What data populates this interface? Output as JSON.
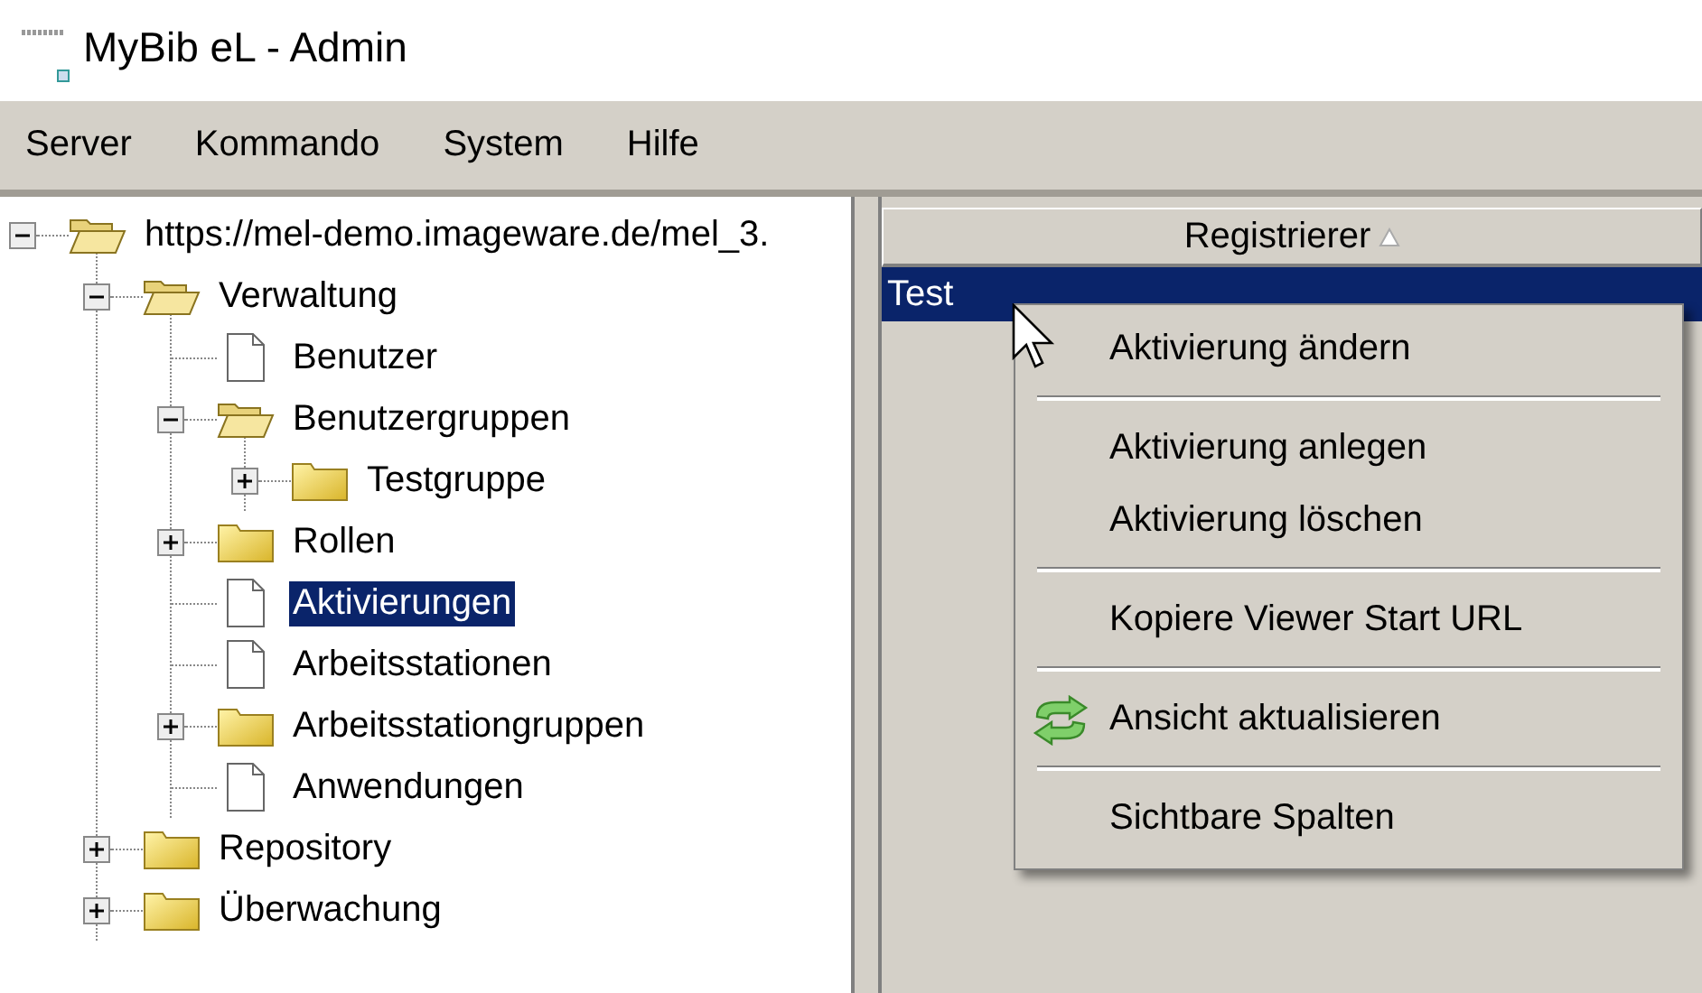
{
  "window": {
    "title": "MyBib eL - Admin"
  },
  "menu_bar": [
    "Server",
    "Kommando",
    "System",
    "Hilfe"
  ],
  "tree": [
    {
      "label": "https://mel-demo.imageware.de/mel_3.",
      "kind": "folder",
      "expanded": true,
      "selected": false,
      "children": [
        {
          "label": "Verwaltung",
          "kind": "folder",
          "expanded": true,
          "selected": false,
          "children": [
            {
              "label": "Benutzer",
              "kind": "page",
              "selected": false
            },
            {
              "label": "Benutzergruppen",
              "kind": "folder",
              "expanded": true,
              "selected": false,
              "children": [
                {
                  "label": "Testgruppe",
                  "kind": "folder",
                  "expanded": false,
                  "selected": false
                }
              ]
            },
            {
              "label": "Rollen",
              "kind": "folder",
              "expanded": false,
              "selected": false
            },
            {
              "label": "Aktivierungen",
              "kind": "page",
              "selected": true
            },
            {
              "label": "Arbeitsstationen",
              "kind": "page",
              "selected": false
            },
            {
              "label": "Arbeitsstationgruppen",
              "kind": "folder",
              "expanded": false,
              "selected": false
            },
            {
              "label": "Anwendungen",
              "kind": "page",
              "selected": false
            }
          ]
        },
        {
          "label": "Repository",
          "kind": "folder",
          "expanded": false,
          "selected": false
        },
        {
          "label": "Überwachung",
          "kind": "folder",
          "expanded": false,
          "selected": false
        }
      ]
    }
  ],
  "table": {
    "columns": [
      {
        "label": "Registrierer",
        "sorted_ascending": true
      }
    ],
    "rows": [
      {
        "cells": [
          "Test"
        ],
        "selected": true
      }
    ]
  },
  "context_menu": [
    {
      "kind": "action",
      "label": "Aktivierung ändern"
    },
    {
      "kind": "separator"
    },
    {
      "kind": "action",
      "label": "Aktivierung anlegen"
    },
    {
      "kind": "action",
      "label": "Aktivierung löschen"
    },
    {
      "kind": "separator"
    },
    {
      "kind": "action",
      "label": "Kopiere Viewer Start URL"
    },
    {
      "kind": "separator"
    },
    {
      "kind": "refresh_action",
      "label": "Ansicht aktualisieren"
    },
    {
      "kind": "separator"
    },
    {
      "kind": "action",
      "label": "Sichtbare Spalten"
    }
  ]
}
